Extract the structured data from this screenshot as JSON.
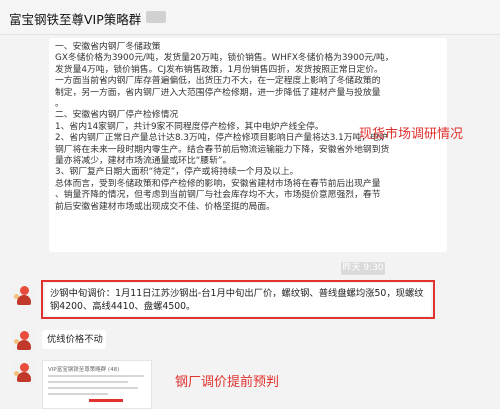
{
  "window": {
    "title": "富宝钢铁至尊VIP策略群"
  },
  "card": {
    "lines": [
      "一、安徽省内钢厂冬储政策",
      "GX冬储价格为3900元/吨，发货量20万吨，锁价销售。WHFX冬储价格为3900元/吨，",
      "发货量4万吨，锁价销售。CJ发布销售政策，1月份销售四折，发货按照正常日定价。",
      "一方面当前省内钢厂库存普遍偏低，出货压力不大，在一定程度上影响了冬储政策的",
      "制定，另一方面，省内钢厂进入大范围停产检修期，进一步降低了建材产量与投放量",
      "。",
      "二、安徽省内钢厂停产检修情况",
      "1、省内14家钢厂，共计9家不同程度停产检修，其中电炉产线全停。",
      "2、省内钢厂正常日产量总计达8.3万吨，停产检修项目影响日产量将达3.1万吨，电炉",
      "钢厂将在未来一段时期内零生产。结合春节前后物流运输能力下降，安徽省外地钢到货",
      "量亦将减少，建材市场流通量或环比“腰斩”。",
      "3、钢厂复产日期大面积“待定”，停产或将持续一个月及以上。",
      "总体而言，受到冬储政策和停产检修的影响，安徽省建材市场将在春节前后出现产量",
      "、销量齐降的情况，但考虑到当前钢厂与社会库存均不大，市场挺价意愿强烈，春节",
      "前后安徽省建材市场或出现成交不佳、价格坚挺的局面。"
    ]
  },
  "annotations": {
    "survey": "现货市场调研情况",
    "forecast": "钢厂调价提前预判"
  },
  "timestamp": "昨天 9:30",
  "messages": [
    {
      "text": "沙钢中旬调价：1月11日江苏沙钢出-台1月中旬出厂价，螺纹钢、普线盘螺均涨50，现螺纹钢4200、高线4410、盘螺4500。"
    },
    {
      "text": "优线价格不动"
    }
  ],
  "image_message": {
    "title": "VIP富宝钢铁至尊策略群 (48)"
  },
  "colors": {
    "highlight_red": "#e0322e",
    "chat_bg": "#f3f3f3",
    "bubble_bg": "#ffffff"
  }
}
